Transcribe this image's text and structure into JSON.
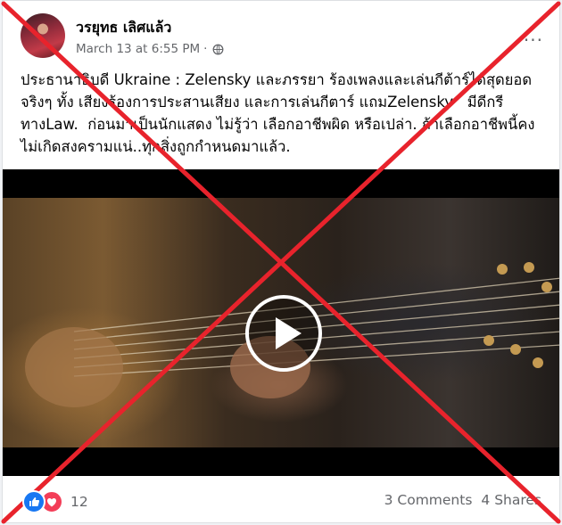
{
  "post": {
    "author": "วรยุทธ เลิศแล้ว",
    "timestamp": "March 13 at 6:55 PM",
    "separator": "·",
    "privacy_icon": "globe-icon",
    "more_label": "...",
    "text": "ประธานาธิบดี Ukraine : Zelensky และภรรยา ร้องเพลงและเล่นกีต้าร์ได้สุดยอดจริงๆ ทั้ง เสียงร้องการประสานเสียง และการเล่นกีตาร์ แถมZelensky   มีดีกรีทางLaw.  ก่อนมาเป็นนักแสดง ไม่รู้ว่า เลือกอาชีพผิด หรือเปล่า. ถ้าเลือกอาชีพนี้คงไม่เกิดสงครามแน่..ทุกสิ่งถูกกำหนดมาแล้ว."
  },
  "video": {
    "play_icon": "play-icon"
  },
  "footer": {
    "reaction_icons": [
      "like-icon",
      "love-icon"
    ],
    "reaction_count": "12",
    "comments": "3 Comments",
    "shares": "4 Shares"
  },
  "overlay": {
    "mark": "red-x-cross",
    "color": "#e8232c"
  },
  "colors": {
    "like": "#1877f2",
    "love": "#f33e58",
    "secondary_text": "#65676b"
  }
}
